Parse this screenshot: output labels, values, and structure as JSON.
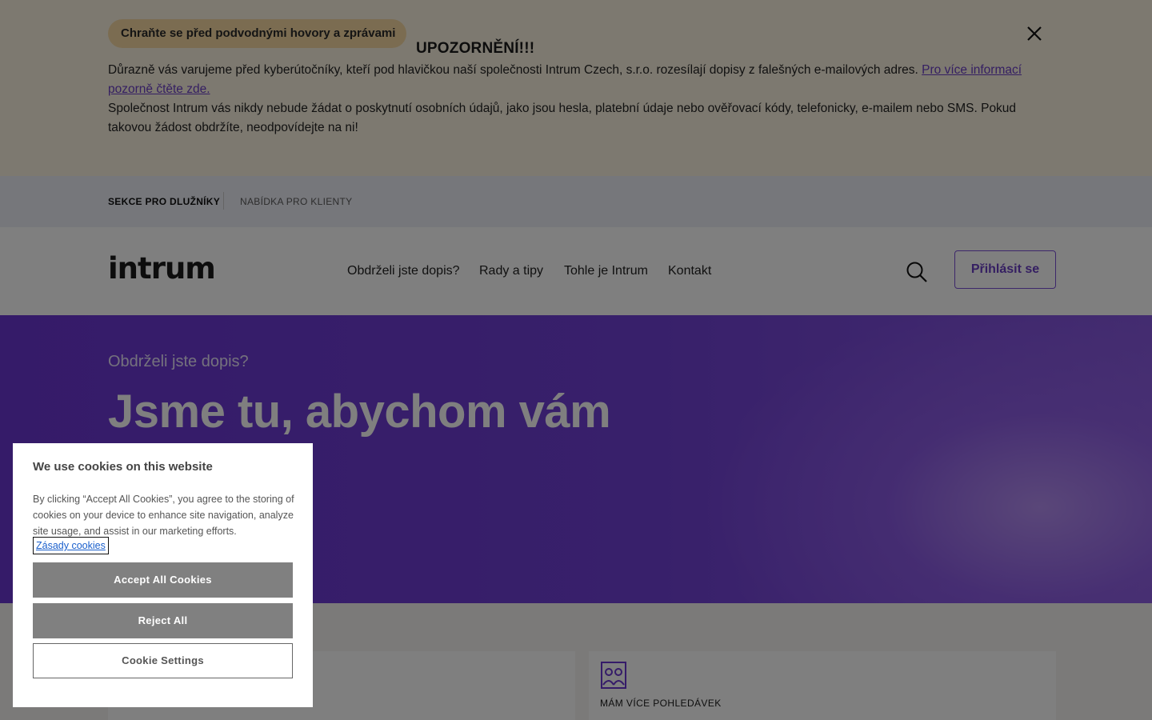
{
  "alert": {
    "pill": "Chraňte se před podvodnými hovory a zprávami",
    "title": "UPOZORNĚNÍ!!!",
    "text_part1": "Důrazně vás varujeme před kyberútočníky, kteří pod hlavičkou naší společnosti Intrum Czech, s.r.o. rozesílají dopisy z falešných e-mailových adres. ",
    "link": "Pro více informací pozorně čtěte zde.",
    "text_part2": "Společnost Intrum vás nikdy nebude žádat o poskytnutí osobních údajů, jako jsou hesla, platební údaje nebo ověřovací kódy, telefonicky, e-mailem nebo SMS. Pokud takovou žádost obdržíte, neodpovídejte na ni!",
    "close_icon": "close-icon"
  },
  "segments": {
    "debtors": "SEKCE PRO DLUŽNÍKY",
    "clients": "NABÍDKA PRO KLIENTY"
  },
  "header": {
    "logo": "intrum",
    "nav": [
      "Obdrželi jste dopis?",
      "Rady a tipy",
      "Tohle je Intrum",
      "Kontakt"
    ],
    "search_icon": "search-icon",
    "login": "Přihlásit se"
  },
  "hero": {
    "kicker": "Obdrželi jste dopis?",
    "title": "Jsme tu, abychom vám"
  },
  "cards": [
    {
      "label": "",
      "icon": "document-icon"
    },
    {
      "label": "MÁM VÍCE POHLEDÁVEK",
      "icon": "people-icon"
    }
  ],
  "cookie": {
    "title": "We use cookies on this website",
    "text": "By clicking “Accept All Cookies”, you agree to the storing of cookies on your device to enhance site navigation, analyze site usage, and assist in our marketing efforts.",
    "link": "Zásady cookies",
    "accept": "Accept All Cookies",
    "reject": "Reject All",
    "settings": "Cookie Settings"
  },
  "colors": {
    "brand_purple": "#6b36d3",
    "alert_bg": "#faf2e0",
    "pill_bg": "#f6d9a3"
  }
}
